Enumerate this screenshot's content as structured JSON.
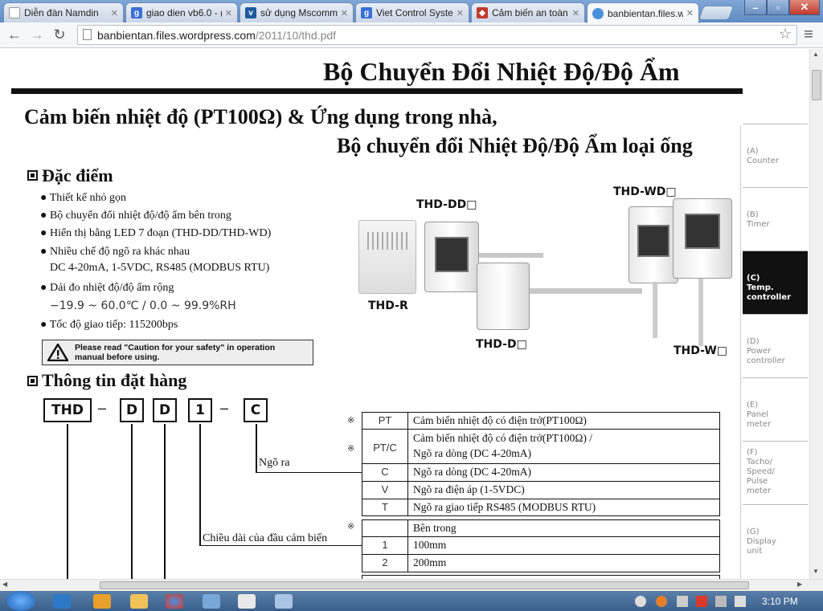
{
  "browser": {
    "tabs": [
      {
        "title": "Diễn đàn Namdin",
        "icon": "page-icon"
      },
      {
        "title": "giao dien vb6.0 - (",
        "icon": "google-icon"
      },
      {
        "title": "sử dụng Mscomm",
        "icon": "site-icon"
      },
      {
        "title": "Viet Control Syste",
        "icon": "google-icon"
      },
      {
        "title": "Cảm biến an toàn",
        "icon": "shop-icon"
      },
      {
        "title": "banbientan.files.w",
        "icon": "loading-icon"
      }
    ],
    "url_host": "banbientan.files.wordpress.com",
    "url_path": "/2011/10/thd.pdf"
  },
  "doc": {
    "header_title": "Bộ Chuyển Đổi Nhiệt Độ/Độ Ẩm",
    "subtitle_line1": "Cảm biến nhiệt độ (PT100Ω) & Ứng dụng trong nhà,",
    "subtitle_line2": "Bộ chuyển đổi Nhiệt Độ/Độ Ẩm loại ống",
    "features_heading": "Đặc điểm",
    "features": [
      "Thiết kế nhỏ gọn",
      "Bộ chuyển đổi nhiệt độ/độ ẩm bên trong",
      "Hiển thị bằng LED 7 đoạn (THD-DD/THD-WD)",
      "Nhiều chế độ ngõ ra khác nhau",
      "Dải đo nhiệt độ/độ ẩm rộng",
      "Tốc độ giao tiếp: 115200bps"
    ],
    "feature_output_detail": "DC 4-20mA, 1-5VDC, RS485 (MODBUS RTU)",
    "feature_range_detail": "−19.9 ~ 60.0℃ / 0.0 ~ 99.9%RH",
    "caution_line1": "Please read \"Caution for your safety\" in operation",
    "caution_line2": "manual before using.",
    "products": [
      "THD-DD□",
      "THD-WD□",
      "THD-R",
      "THD-D□",
      "THD-W□"
    ],
    "ordering_heading": "Thông tin đặt hàng",
    "order_code": [
      "THD",
      "D",
      "D",
      "1",
      "C"
    ],
    "order_sep": "–",
    "label_output": "Ngõ ra",
    "label_length": "Chiều dài của đầu cảm biến",
    "star": "※",
    "output_table": [
      {
        "code": "PT",
        "desc": "Cảm biến nhiệt độ có điện trở(PT100Ω)"
      },
      {
        "code": "PT/C",
        "desc": "Cảm biến nhiệt độ có điện trở(PT100Ω) /",
        "desc2": "Ngõ ra dòng (DC 4-20mA)"
      },
      {
        "code": "C",
        "desc": "Ngõ ra dòng (DC 4-20mA)"
      },
      {
        "code": "V",
        "desc": "Ngõ ra điện áp (1-5VDC)"
      },
      {
        "code": "T",
        "desc": "Ngõ ra giao tiếp RS485 (MODBUS RTU)"
      }
    ],
    "length_table": [
      {
        "code": "",
        "desc": "Bên trong"
      },
      {
        "code": "1",
        "desc": "100mm"
      },
      {
        "code": "2",
        "desc": "200mm"
      }
    ],
    "side_tabs": [
      {
        "code": "(A)",
        "lines": [
          "Counter"
        ]
      },
      {
        "code": "(B)",
        "lines": [
          "Timer"
        ]
      },
      {
        "code": "(C)",
        "lines": [
          "Temp.",
          "controller"
        ]
      },
      {
        "code": "(D)",
        "lines": [
          "Power",
          "controller"
        ]
      },
      {
        "code": "(E)",
        "lines": [
          "Panel",
          "meter"
        ]
      },
      {
        "code": "(F)",
        "lines": [
          "Tacho/",
          "Speed/",
          "Pulse",
          "meter"
        ]
      },
      {
        "code": "(G)",
        "lines": [
          "Display",
          "unit"
        ]
      }
    ]
  },
  "taskbar": {
    "clock": "3:10 PM"
  }
}
